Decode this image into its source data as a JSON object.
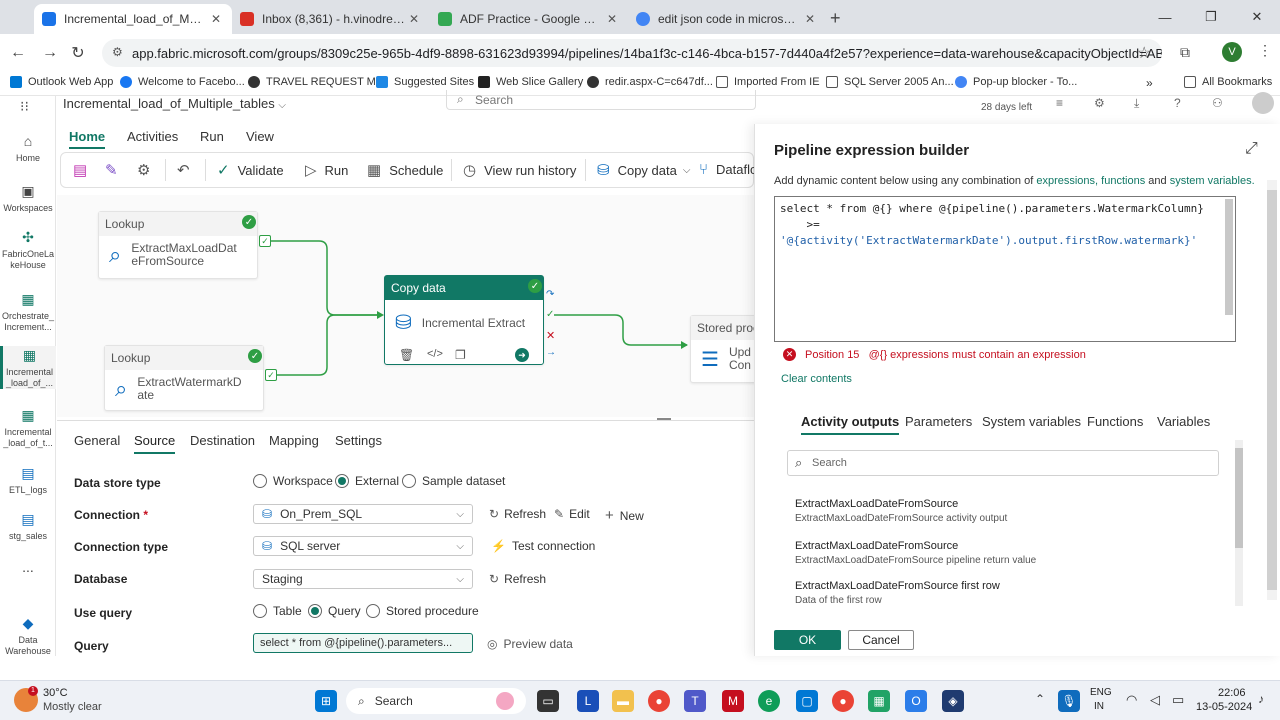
{
  "browser": {
    "tabs": [
      {
        "title": "Incremental_load_of_Multiple_t",
        "color": "#1a73e8",
        "active": true
      },
      {
        "title": "Inbox (8,361) - h.vinodreddy99",
        "color": "#d93025",
        "active": false
      },
      {
        "title": "ADF Practice - Google Drive",
        "color": "#34a853",
        "active": false
      },
      {
        "title": "edit json code in microsoft fabr",
        "color": "#4285f4",
        "active": false
      }
    ],
    "url": "app.fabric.microsoft.com/groups/8309c25e-965b-4df9-8898-631623d93994/pipelines/14ba1f3c-c146-4bca-b157-7d440a4f2e57?experience=data-warehouse&capacityObjectId=AB1331F1-CD7...",
    "profile_initial": "V",
    "bookmarks": [
      "Outlook Web App",
      "Welcome to Facebo...",
      "TRAVEL REQUEST M...",
      "Suggested Sites",
      "Web Slice Gallery",
      "redir.aspx-C=c647df...",
      "Imported From IE",
      "SQL Server 2005 An...",
      "Pop-up blocker - To..."
    ],
    "all_bookmarks": "All Bookmarks"
  },
  "app": {
    "pipeline_name": "Incremental_load_of_Multiple_tables",
    "search_placeholder": "Search",
    "trial": "28 days left",
    "rail": [
      {
        "label": "Home",
        "icon": "⌂"
      },
      {
        "label": "Workspaces",
        "icon": "▣"
      },
      {
        "label": "FabricOneLa\nkeHouse",
        "icon": "✣"
      },
      {
        "label": "Orchestrate_\nIncrement...",
        "icon": "▦"
      },
      {
        "label": "Incremental\n_load_of_...",
        "icon": "▦"
      },
      {
        "label": "Incremental\n_load_of_t...",
        "icon": "▦"
      },
      {
        "label": "ETL_logs",
        "icon": "▤"
      },
      {
        "label": "stg_sales",
        "icon": "▤"
      },
      {
        "label": "...",
        "icon": ""
      },
      {
        "label": "Data\nWarehouse",
        "icon": "◆"
      }
    ],
    "ribbon_tabs": [
      "Home",
      "Activities",
      "Run",
      "View"
    ],
    "toolbar": {
      "validate": "Validate",
      "run": "Run",
      "schedule": "Schedule",
      "view_run_history": "View run history",
      "copy_data": "Copy data",
      "dataflow": "Dataflo"
    },
    "nodes": {
      "lookup1": {
        "header": "Lookup",
        "name": "ExtractMaxLoadDat\neFromSource"
      },
      "lookup2": {
        "header": "Lookup",
        "name": "ExtractWatermarkD\nate"
      },
      "copy": {
        "header": "Copy data",
        "name": "Incremental Extract"
      },
      "stored": {
        "header": "Stored proc",
        "name": "Upd\nCon"
      }
    },
    "panel_tabs": [
      "General",
      "Source",
      "Destination",
      "Mapping",
      "Settings"
    ],
    "source": {
      "data_store_type_label": "Data store type",
      "data_store_options": [
        "Workspace",
        "External",
        "Sample dataset"
      ],
      "connection_label": "Connection",
      "connection_value": "On_Prem_SQL",
      "refresh": "Refresh",
      "edit": "Edit",
      "new": "New",
      "connection_type_label": "Connection type",
      "connection_type_value": "SQL server",
      "test_connection": "Test connection",
      "database_label": "Database",
      "database_value": "Staging",
      "use_query_label": "Use query",
      "use_query_options": [
        "Table",
        "Query",
        "Stored procedure"
      ],
      "query_label": "Query",
      "query_value": "select * from @{pipeline().parameters...",
      "preview_data": "Preview data"
    }
  },
  "builder": {
    "title": "Pipeline expression builder",
    "hint_prefix": "Add dynamic content below using any combination of",
    "hint_expr": "expressions,",
    "hint_funcs": "functions",
    "hint_and": "and",
    "hint_sysvars": "system variables.",
    "code_line1": "select * from @{} where @{pipeline().parameters.WatermarkColumn}",
    "code_line2": "    >=",
    "code_line3": "'@{activity('ExtractWatermarkDate').output.firstRow.watermark}'",
    "error_position": "Position 15",
    "error_message": "@{} expressions must contain an expression",
    "clear_contents": "Clear contents",
    "tabs": [
      "Activity outputs",
      "Parameters",
      "System variables",
      "Functions",
      "Variables"
    ],
    "search_placeholder": "Search",
    "outputs": [
      {
        "title": "ExtractMaxLoadDateFromSource",
        "sub": "ExtractMaxLoadDateFromSource activity output"
      },
      {
        "title": "ExtractMaxLoadDateFromSource",
        "sub": "ExtractMaxLoadDateFromSource pipeline return value"
      },
      {
        "title": "ExtractMaxLoadDateFromSource first row",
        "sub": "Data of the first row"
      }
    ],
    "ok": "OK",
    "cancel": "Cancel"
  },
  "taskbar": {
    "weather_temp": "30°C",
    "weather_desc": "Mostly clear",
    "search": "Search",
    "lang1": "ENG",
    "lang2": "IN",
    "time": "22:06",
    "date": "13-05-2024"
  },
  "colors": {
    "accent": "#117865",
    "error": "#c50f1f",
    "success": "#2e9e44"
  }
}
